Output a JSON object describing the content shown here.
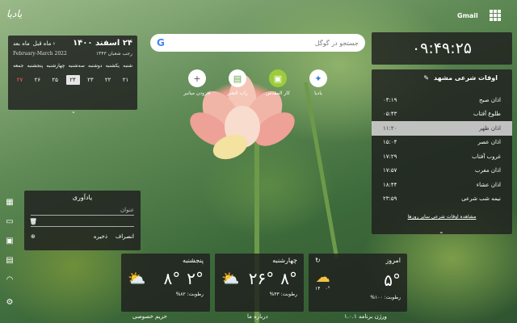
{
  "brand": {
    "logo_text": "یادیا"
  },
  "topbar": {
    "gmail_label": "Gmail",
    "apps_icon": "apps-grid-icon"
  },
  "calendar": {
    "title": "۲۴ اسفند ۱۴۰۰",
    "prev_label": "ماه قبل",
    "next_label": "ماه بعد",
    "hijri": "رجب شعبان ۱۴۴۳",
    "gregorian": "February-March 2022",
    "weekdays": [
      "شنبه",
      "یکشنبه",
      "دوشنبه",
      "سه‌شنبه",
      "چهارشنبه",
      "پنجشنبه",
      "جمعه"
    ],
    "days": [
      "۲۱",
      "۲۲",
      "۲۳",
      "۲۴",
      "۲۵",
      "۲۶",
      "۲۷"
    ],
    "today_index": 3,
    "holiday_index": 6
  },
  "search": {
    "placeholder": "جستجو در گوگل",
    "logo": "G"
  },
  "shortcuts": [
    {
      "label": "یادیا",
      "icon": "yadia-icon"
    },
    {
      "label": "کار المقدس",
      "icon": "book-icon"
    },
    {
      "label": "راب التعبر",
      "icon": "image-icon"
    },
    {
      "label": "افزودن میانبر",
      "icon": "plus-icon"
    }
  ],
  "clock": {
    "time": "۰۹:۴۹:۲۵"
  },
  "prayer": {
    "title": "اوقات شرعی مشهد",
    "rows": [
      {
        "name": "اذان صبح",
        "time": "۰۴:۱۹"
      },
      {
        "name": "طلوع آفتاب",
        "time": "۰۵:۴۳"
      },
      {
        "name": "اذان ظهر",
        "time": "۱۱:۲۰"
      },
      {
        "name": "اذان عصر",
        "time": "۱۵:۰۴"
      },
      {
        "name": "غروب آفتاب",
        "time": "۱۷:۲۹"
      },
      {
        "name": "اذان مغرب",
        "time": "۱۷:۵۷"
      },
      {
        "name": "اذان عشاء",
        "time": "۱۸:۴۴"
      },
      {
        "name": "نیمه شب شرعی",
        "time": "۲۳:۵۹"
      }
    ],
    "active_index": 2,
    "link": "مشاهده اوقات شرعی سایر روزها"
  },
  "reminder": {
    "title": "یادآوری",
    "title_placeholder": "عنوان",
    "save_label": "ذخیره",
    "cancel_label": "انصراف"
  },
  "weather": [
    {
      "day": "امروز",
      "max": "۵°",
      "min": "۰°",
      "humidity": "رطوبت: ۱۰۰%",
      "precip": "۱۴",
      "has_refresh": true
    },
    {
      "day": "چهارشنبه",
      "max": "۸°",
      "min": "۲۶°",
      "humidity": "رطوبت: ۳۳%"
    },
    {
      "day": "پنجشنبه",
      "max": "۲°",
      "min": "۸°",
      "humidity": "رطوبت: ۸۲%"
    }
  ],
  "footer": {
    "version": "ورژن برنامه ۱.۰.۱",
    "about": "درباره ما",
    "privacy": "حریم خصوصی"
  }
}
